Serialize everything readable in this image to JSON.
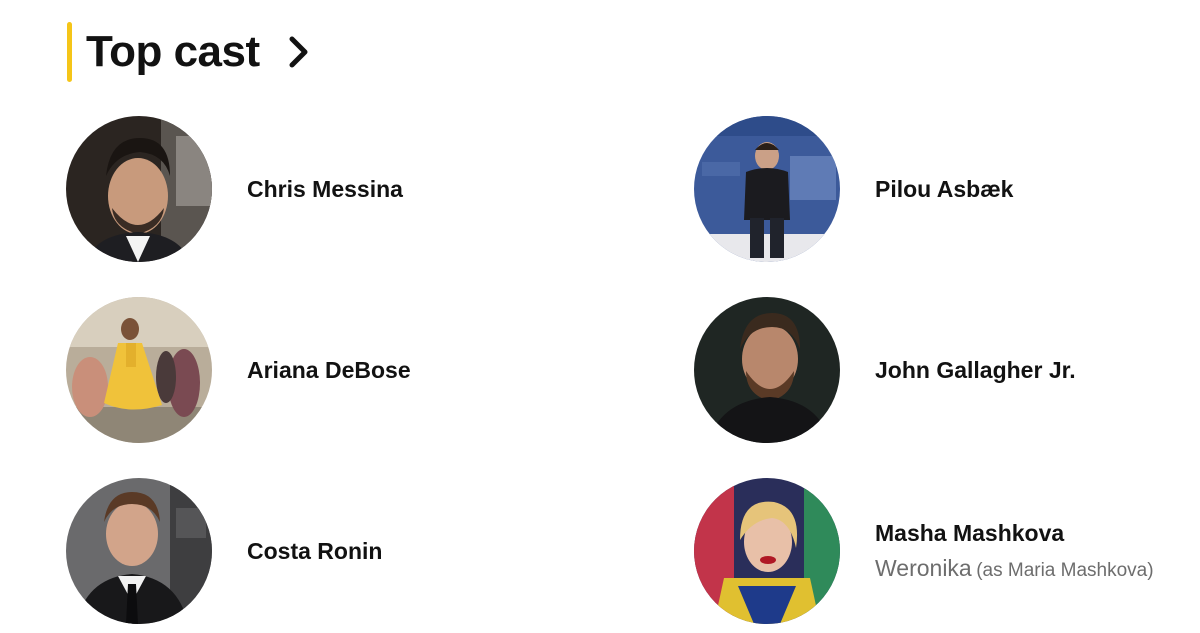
{
  "section": {
    "title": "Top cast",
    "accent_color": "#f5c518",
    "chevron_icon": "chevron-right-icon"
  },
  "cast": [
    {
      "name": "Chris Messina"
    },
    {
      "name": "Pilou Asbæk"
    },
    {
      "name": "Ariana DeBose"
    },
    {
      "name": "John Gallagher Jr."
    },
    {
      "name": "Costa Ronin"
    },
    {
      "name": "Masha Mashkova",
      "character": "Weronika",
      "alias": "(as Maria Mashkova)"
    }
  ]
}
